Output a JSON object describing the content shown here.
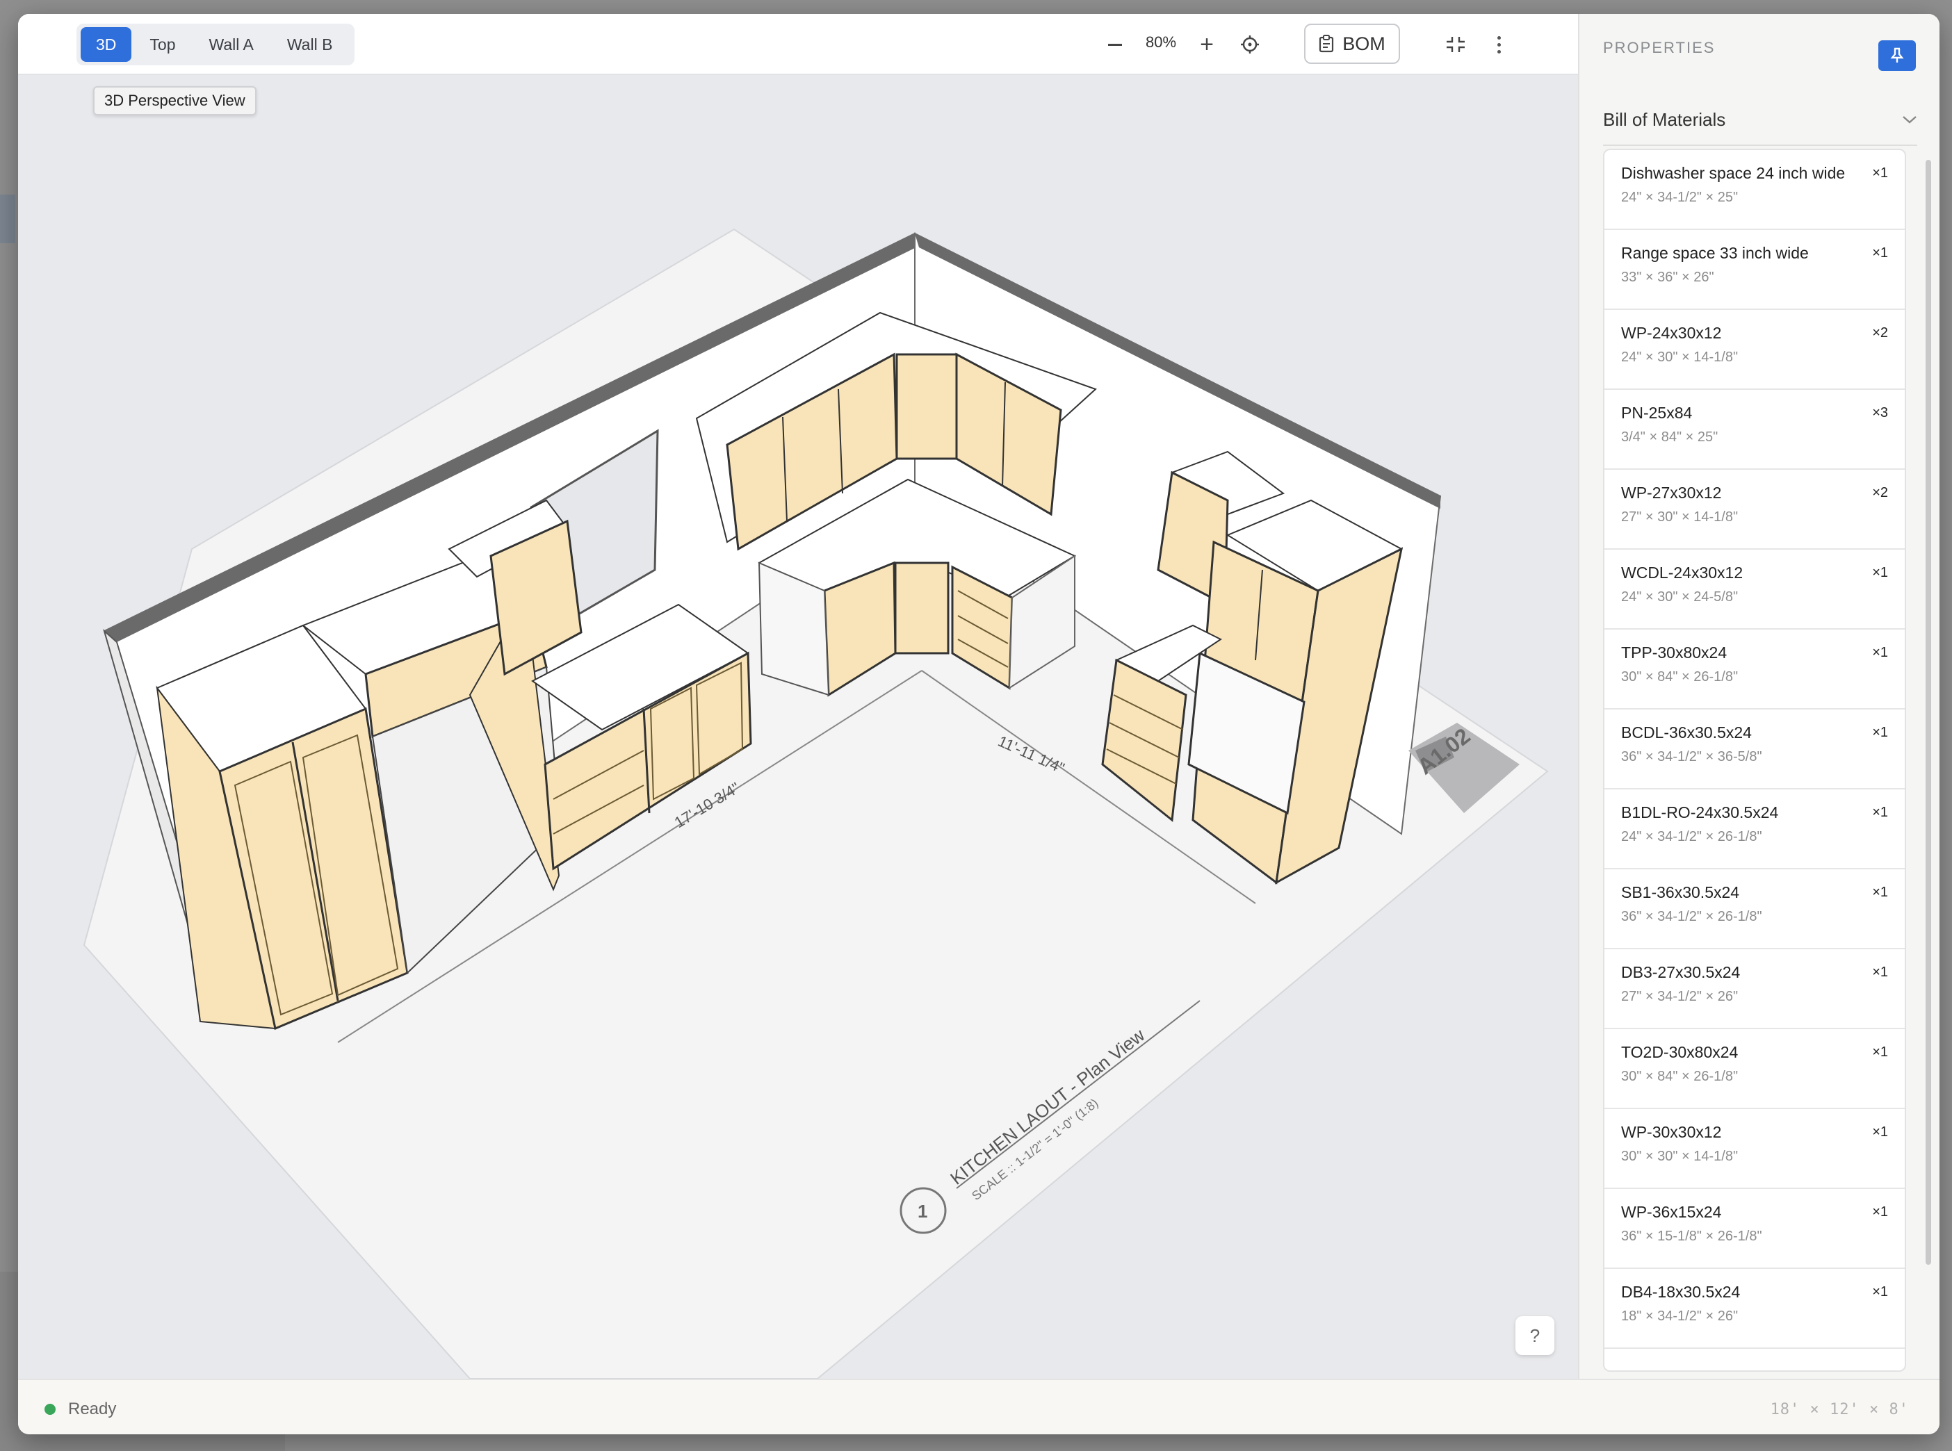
{
  "toolbar": {
    "views": [
      {
        "label": "3D",
        "active": true
      },
      {
        "label": "Top",
        "active": false
      },
      {
        "label": "Wall A",
        "active": false
      },
      {
        "label": "Wall B",
        "active": false
      }
    ],
    "tooltip": "3D Perspective View",
    "zoom": "80%",
    "bom_label": "BOM",
    "icons": {
      "zoom_out": "minus-icon",
      "zoom_in": "plus-icon",
      "recenter": "crosshair-icon",
      "bom": "clipboard-icon",
      "collapse": "collapse-icon",
      "more": "more-vertical-icon"
    }
  },
  "drawing": {
    "dimension_left": "17'-10 3/4\"",
    "dimension_right": "11'-11 1/4\"",
    "plan_title": "KITCHEN LAOUT - Plan View",
    "plan_scale": "SCALE :: 1-1/2\" = 1'-0\" (1:8)",
    "callout_number": "1",
    "sheet_number": "A1.02"
  },
  "help_label": "?",
  "panel": {
    "title": "PROPERTIES",
    "pin_icon": "pin-icon",
    "section_title": "Bill of Materials",
    "section_icon": "chevron-down-icon",
    "items": [
      {
        "name": "Dishwasher space 24 inch wide",
        "qty": "×1",
        "dims": "24\" × 34-1/2\" × 25\""
      },
      {
        "name": "Range space 33 inch wide",
        "qty": "×1",
        "dims": "33\" × 36\" × 26\""
      },
      {
        "name": "WP-24x30x12",
        "qty": "×2",
        "dims": "24\" × 30\" × 14-1/8\""
      },
      {
        "name": "PN-25x84",
        "qty": "×3",
        "dims": "3/4\" × 84\" × 25\""
      },
      {
        "name": "WP-27x30x12",
        "qty": "×2",
        "dims": "27\" × 30\" × 14-1/8\""
      },
      {
        "name": "WCDL-24x30x12",
        "qty": "×1",
        "dims": "24\" × 30\" × 24-5/8\""
      },
      {
        "name": "TPP-30x80x24",
        "qty": "×1",
        "dims": "30\" × 84\" × 26-1/8\""
      },
      {
        "name": "BCDL-36x30.5x24",
        "qty": "×1",
        "dims": "36\" × 34-1/2\" × 36-5/8\""
      },
      {
        "name": "B1DL-RO-24x30.5x24",
        "qty": "×1",
        "dims": "24\" × 34-1/2\" × 26-1/8\""
      },
      {
        "name": "SB1-36x30.5x24",
        "qty": "×1",
        "dims": "36\" × 34-1/2\" × 26-1/8\""
      },
      {
        "name": "DB3-27x30.5x24",
        "qty": "×1",
        "dims": "27\" × 34-1/2\" × 26\""
      },
      {
        "name": "TO2D-30x80x24",
        "qty": "×1",
        "dims": "30\" × 84\" × 26-1/8\""
      },
      {
        "name": "WP-30x30x12",
        "qty": "×1",
        "dims": "30\" × 30\" × 14-1/8\""
      },
      {
        "name": "WP-36x15x24",
        "qty": "×1",
        "dims": "36\" × 15-1/8\" × 26-1/8\""
      },
      {
        "name": "DB4-18x30.5x24",
        "qty": "×1",
        "dims": "18\" × 34-1/2\" × 26\""
      }
    ]
  },
  "status": {
    "text": "Ready",
    "room_dims": "18' × 12' × 8'",
    "colors": {
      "ready": "#3aa65a",
      "accent": "#2f6fdb",
      "cabinet": "#f8e4b8"
    }
  }
}
